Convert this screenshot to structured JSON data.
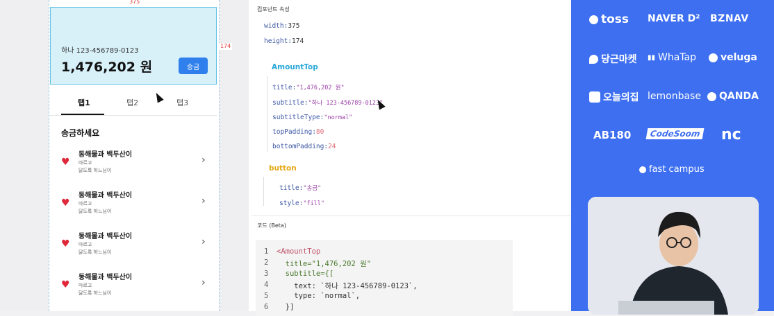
{
  "canvas": {
    "width_label": "375",
    "height_label": "174",
    "amount_top": {
      "subtitle": "하나 123-456789-0123",
      "title": "1,476,202 원",
      "button_label": "송금"
    },
    "tabs": [
      "탭1",
      "탭2",
      "탭3"
    ],
    "section_title": "송금하세요",
    "list_items": [
      {
        "title": "동해물과 백두산이",
        "line1": "마르고",
        "line2": "닳도록 하느님이"
      },
      {
        "title": "동해물과 백두산이",
        "line1": "마르고",
        "line2": "닳도록 하느님이"
      },
      {
        "title": "동해물과 백두산이",
        "line1": "마르고",
        "line2": "닳도록 하느님이"
      },
      {
        "title": "동해물과 백두산이",
        "line1": "마르고",
        "line2": "닳도록 하느님이"
      }
    ]
  },
  "props": {
    "header": "컴포넌트 속성",
    "width_key": "width:",
    "width_val": "375",
    "height_key": "height:",
    "height_val": "174",
    "component": "AmountTop",
    "title_key": "title:",
    "title_val": "\"1,476,202 원\"",
    "subtitle_key": "subtitle:",
    "subtitle_val": "\"하나 123-456789-0123\"",
    "subtitletype_key": "subtitleType:",
    "subtitletype_val": "\"normal\"",
    "toppadding_key": "topPadding:",
    "toppadding_val": "80",
    "bottompadding_key": "bottomPadding:",
    "bottompadding_val": "24",
    "button_label": "button",
    "btn_title_key": "title:",
    "btn_title_val": "\"송금\"",
    "btn_style_key": "style:",
    "btn_style_val": "\"fill\""
  },
  "code": {
    "header": "코드 (Beta)",
    "lines": [
      {
        "n": "1",
        "text": "<AmountTop"
      },
      {
        "n": "2",
        "text": "  title=\"1,476,202 원\""
      },
      {
        "n": "3",
        "text": "  subtitle={["
      },
      {
        "n": "4",
        "text": "    text: `하나 123-456789-0123`,"
      },
      {
        "n": "5",
        "text": "    type: `normal`,"
      },
      {
        "n": "6",
        "text": "  }]"
      }
    ]
  },
  "sponsors": [
    "toss",
    "NAVER D²",
    "BZNAV",
    "당근마켓",
    "WhaTap",
    "veluga",
    "오늘의집",
    "lemonbase",
    "QANDA",
    "AB180",
    "CodeSoom",
    "nc",
    "fast campus"
  ]
}
